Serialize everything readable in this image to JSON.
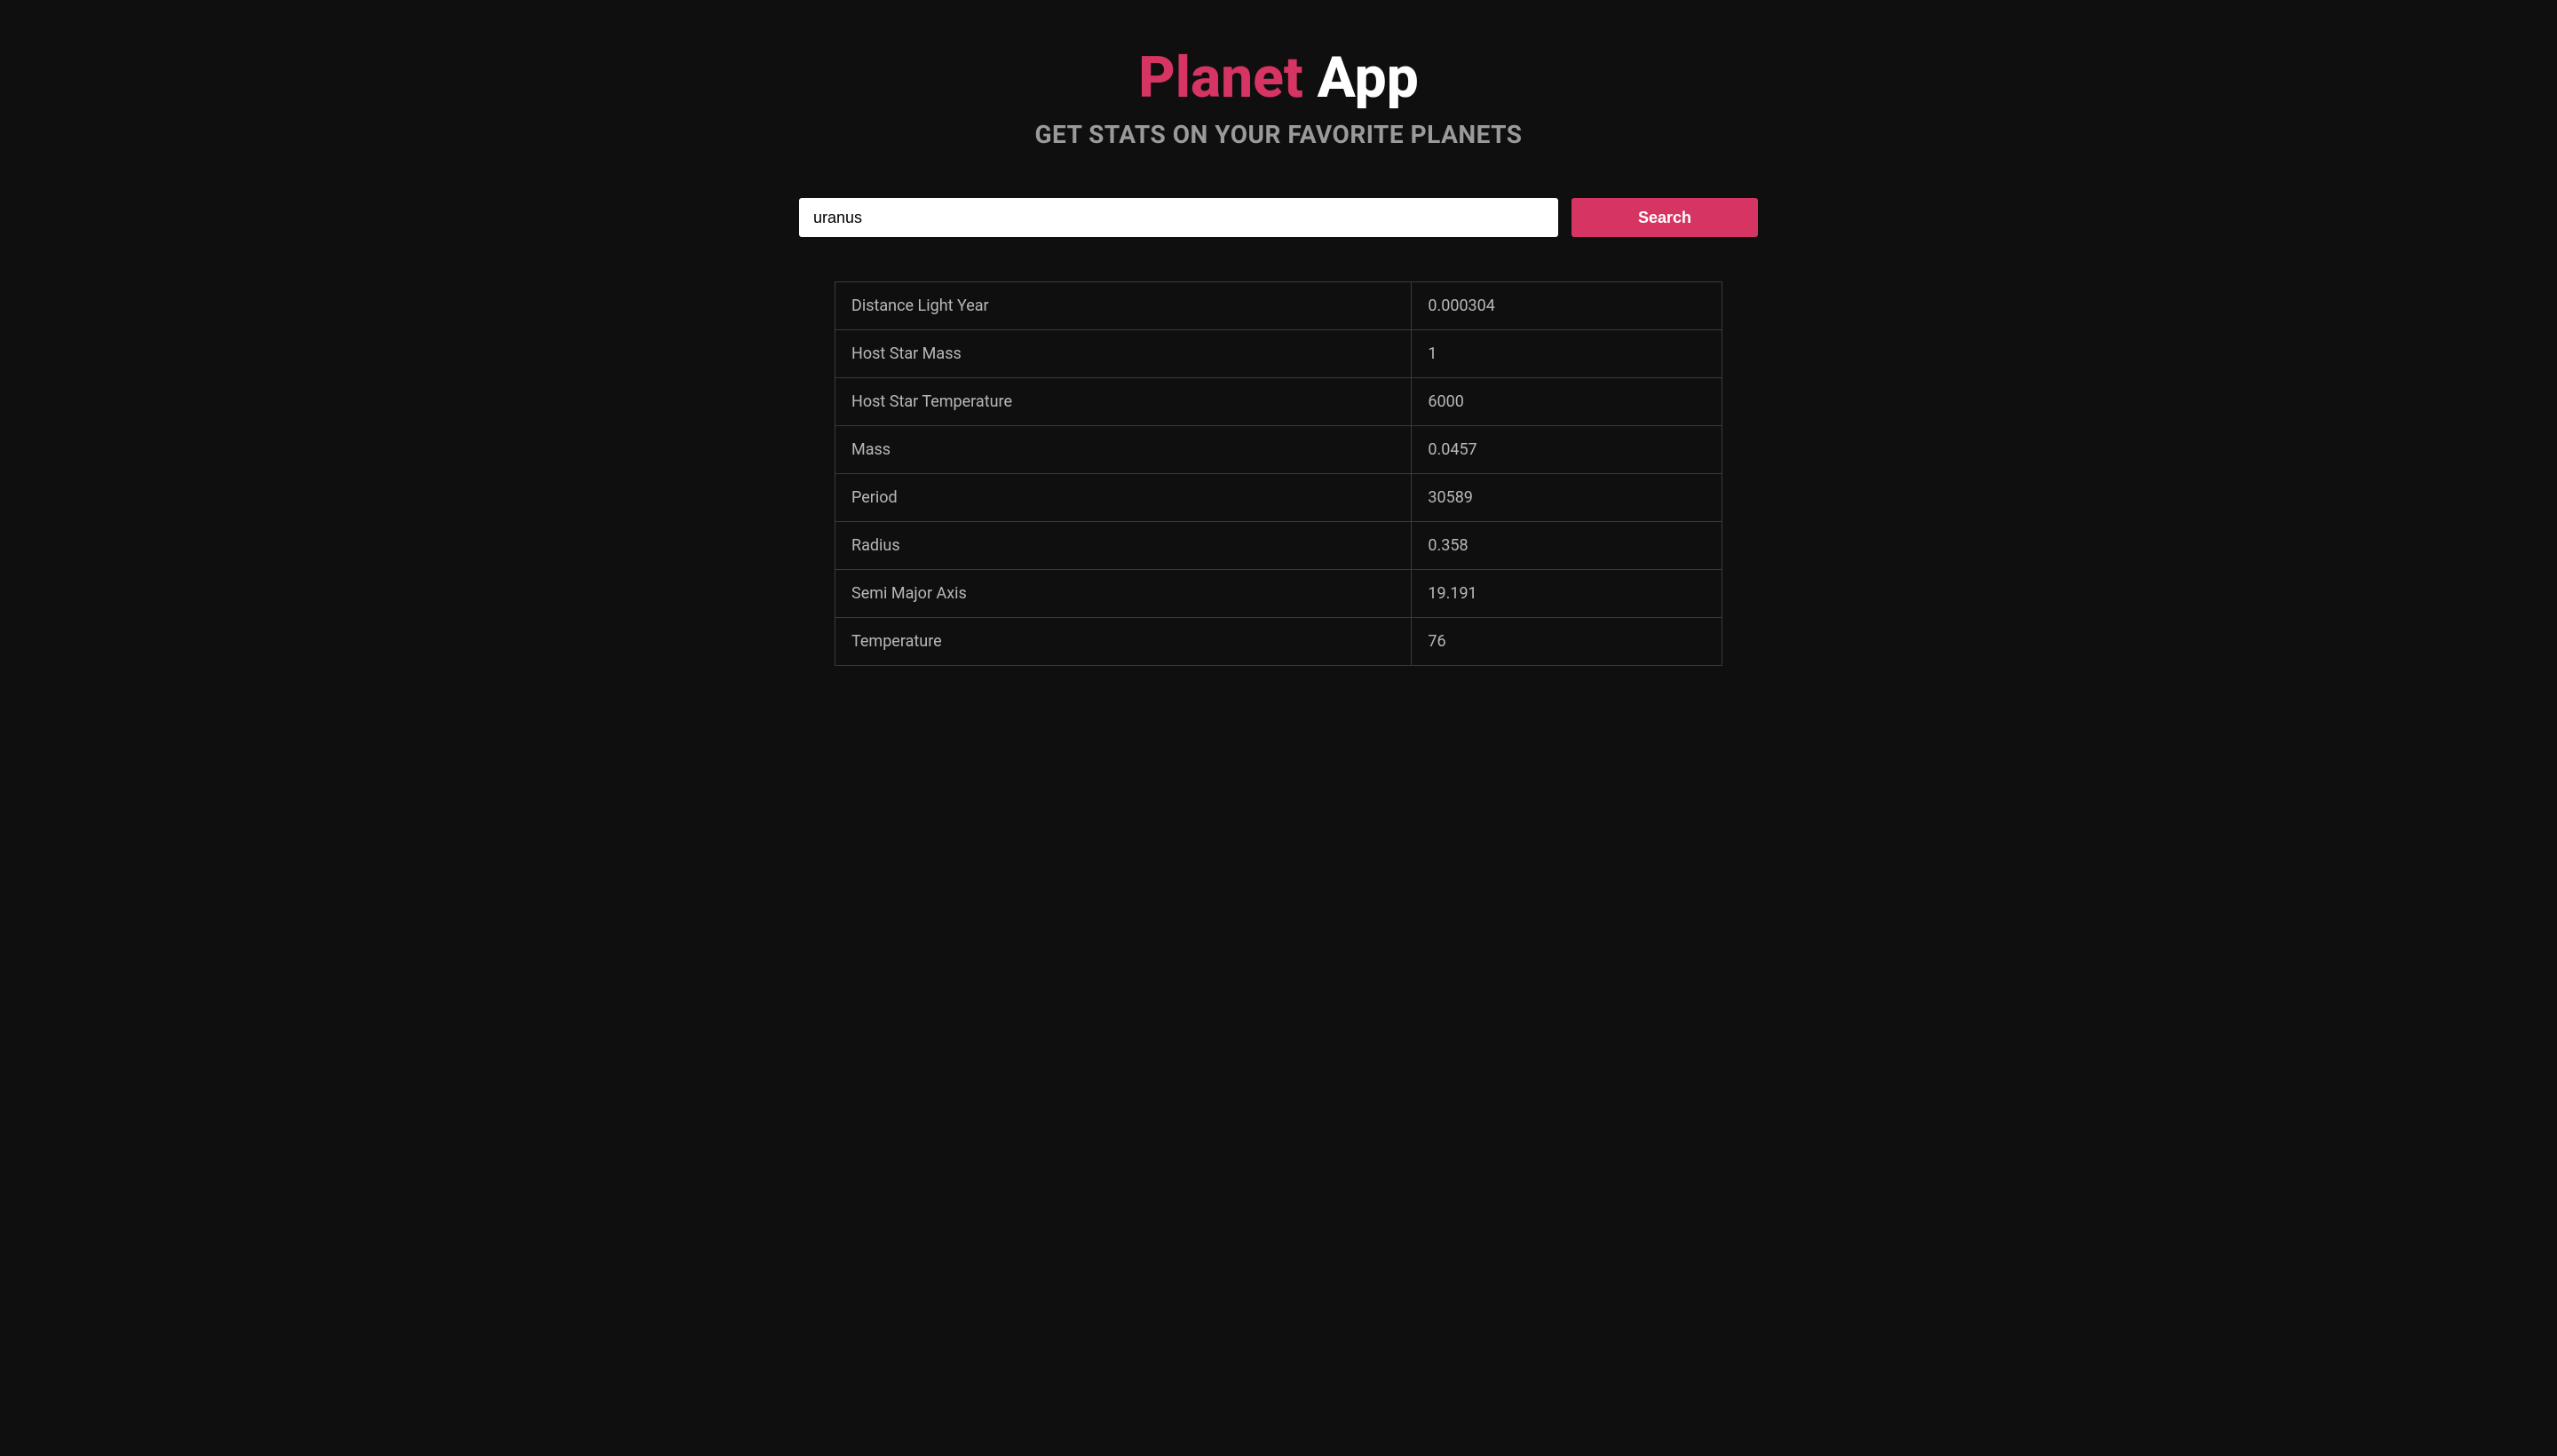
{
  "header": {
    "title_accent": "Planet",
    "title_main": "App",
    "subtitle": "GET STATS ON YOUR FAVORITE PLANETS"
  },
  "search": {
    "value": "uranus",
    "button_label": "Search"
  },
  "stats": {
    "rows": [
      {
        "label": "Distance Light Year",
        "value": "0.000304"
      },
      {
        "label": "Host Star Mass",
        "value": "1"
      },
      {
        "label": "Host Star Temperature",
        "value": "6000"
      },
      {
        "label": "Mass",
        "value": "0.0457"
      },
      {
        "label": "Period",
        "value": "30589"
      },
      {
        "label": "Radius",
        "value": "0.358"
      },
      {
        "label": "Semi Major Axis",
        "value": "19.191"
      },
      {
        "label": "Temperature",
        "value": "76"
      }
    ]
  },
  "colors": {
    "accent": "#d63563",
    "background": "#0f0f0f",
    "subtitle": "#9a9a9a",
    "text": "#b8b8b8",
    "border": "#3a3a3a"
  }
}
